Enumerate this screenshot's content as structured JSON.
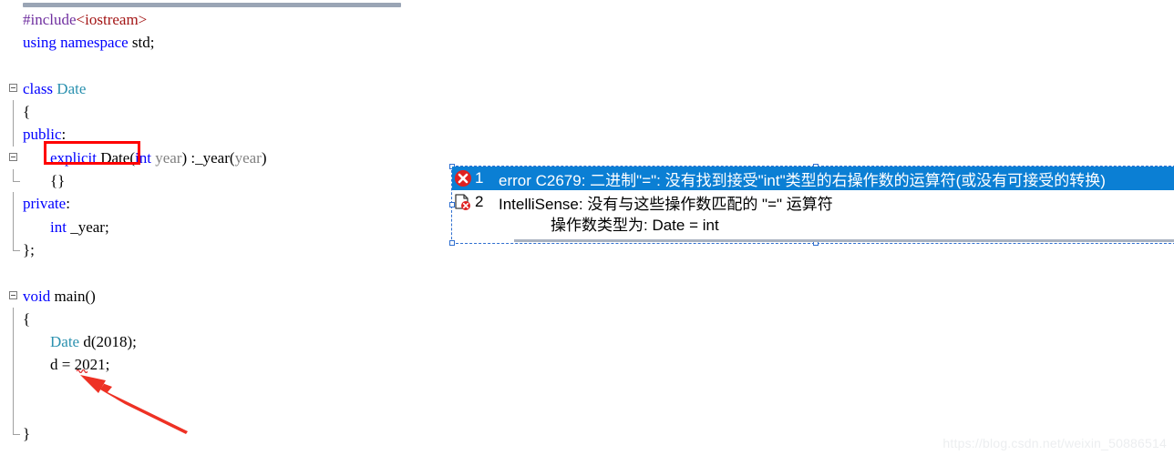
{
  "editor": {
    "language": "cpp",
    "lines": [
      {
        "indent": 0,
        "fold": "none",
        "tokens": [
          {
            "t": "#include",
            "c": "pre"
          },
          {
            "t": "<iostream>",
            "c": "str"
          }
        ]
      },
      {
        "indent": 0,
        "fold": "none",
        "tokens": [
          {
            "t": "using",
            "c": "kw"
          },
          {
            "t": " ",
            "c": "plain"
          },
          {
            "t": "namespace",
            "c": "kw"
          },
          {
            "t": " std;",
            "c": "plain"
          }
        ]
      },
      {
        "indent": 0,
        "fold": "none",
        "tokens": []
      },
      {
        "indent": 0,
        "fold": "box",
        "tokens": [
          {
            "t": "class",
            "c": "kw"
          },
          {
            "t": " ",
            "c": "plain"
          },
          {
            "t": "Date",
            "c": "type"
          }
        ]
      },
      {
        "indent": 0,
        "fold": "line",
        "tokens": [
          {
            "t": "{",
            "c": "plain"
          }
        ]
      },
      {
        "indent": 0,
        "fold": "line",
        "tokens": [
          {
            "t": "public",
            "c": "kw"
          },
          {
            "t": ":",
            "c": "plain"
          }
        ]
      },
      {
        "indent": 1,
        "fold": "box",
        "tokens": [
          {
            "t": "explicit",
            "c": "kw"
          },
          {
            "t": " ",
            "c": "plain"
          },
          {
            "t": "Date",
            "c": "plain"
          },
          {
            "t": "(",
            "c": "plain"
          },
          {
            "t": "int",
            "c": "kw"
          },
          {
            "t": " ",
            "c": "plain"
          },
          {
            "t": "year",
            "c": "param"
          },
          {
            "t": ")",
            "c": "plain"
          },
          {
            "t": " :",
            "c": "plain"
          },
          {
            "t": "_year",
            "c": "plain"
          },
          {
            "t": "(",
            "c": "plain"
          },
          {
            "t": "year",
            "c": "param"
          },
          {
            "t": ")",
            "c": "plain"
          }
        ]
      },
      {
        "indent": 1,
        "fold": "end",
        "tokens": [
          {
            "t": "{}",
            "c": "plain"
          }
        ]
      },
      {
        "indent": 0,
        "fold": "line",
        "tokens": [
          {
            "t": "private",
            "c": "kw"
          },
          {
            "t": ":",
            "c": "plain"
          }
        ]
      },
      {
        "indent": 1,
        "fold": "line",
        "tokens": [
          {
            "t": "int",
            "c": "kw"
          },
          {
            "t": " _year;",
            "c": "plain"
          }
        ]
      },
      {
        "indent": 0,
        "fold": "end",
        "tokens": [
          {
            "t": "};",
            "c": "plain"
          }
        ]
      },
      {
        "indent": 0,
        "fold": "none",
        "tokens": []
      },
      {
        "indent": 0,
        "fold": "box",
        "tokens": [
          {
            "t": "void",
            "c": "kw"
          },
          {
            "t": " main()",
            "c": "plain"
          }
        ]
      },
      {
        "indent": 0,
        "fold": "line",
        "tokens": [
          {
            "t": "{",
            "c": "plain"
          }
        ]
      },
      {
        "indent": 1,
        "fold": "line",
        "tokens": [
          {
            "t": "Date",
            "c": "type"
          },
          {
            "t": " d(2018);",
            "c": "plain"
          }
        ]
      },
      {
        "indent": 1,
        "fold": "line",
        "tokens": [
          {
            "t": "d = 2021;",
            "c": "plain"
          }
        ]
      },
      {
        "indent": 0,
        "fold": "line",
        "tokens": []
      },
      {
        "indent": 0,
        "fold": "line",
        "tokens": []
      },
      {
        "indent": 0,
        "fold": "end",
        "tokens": [
          {
            "t": "}",
            "c": "plain"
          }
        ]
      }
    ]
  },
  "annotations": {
    "explicit_box_label": "explicit-keyword-highlight",
    "arrow_label": "assignment-operator-pointer",
    "arrow_color": "#ee3124",
    "box_color": "#ff0000"
  },
  "error_list": {
    "rows": [
      {
        "index": "1",
        "icon": "error-circle-icon",
        "text": "error C2679: 二进制\"=\": 没有找到接受\"int\"类型的右操作数的运算符(或没有可接受的转换)",
        "selected": true
      },
      {
        "index": "2",
        "icon": "document-error-icon",
        "text": "IntelliSense: 没有与这些操作数匹配的 \"=\" 运算符",
        "selected": false
      }
    ],
    "detail_line": "操作数类型为: Date = int",
    "selection_color": "#0b7fd4"
  },
  "watermark": {
    "text": "https://blog.csdn.net/weixin_50886514"
  }
}
